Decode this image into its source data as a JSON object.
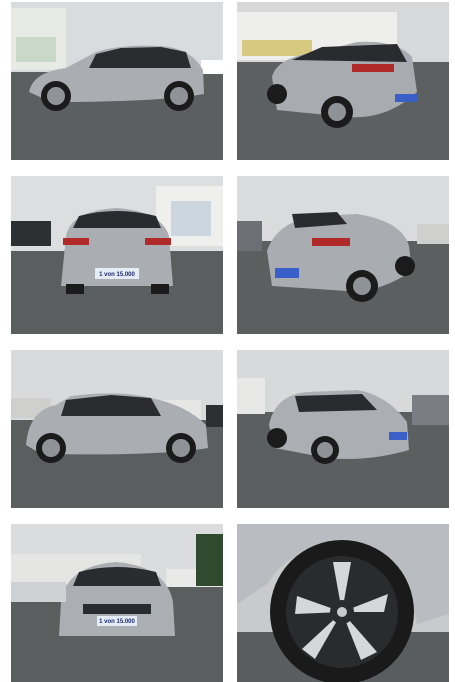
{
  "gallery": {
    "plate_text": "1 von 15.000",
    "car_color": "#a9adb1",
    "roof_color": "#2a2b2e",
    "sky_color": "#d7dadc",
    "ground_color": "#5b5e5f"
  }
}
